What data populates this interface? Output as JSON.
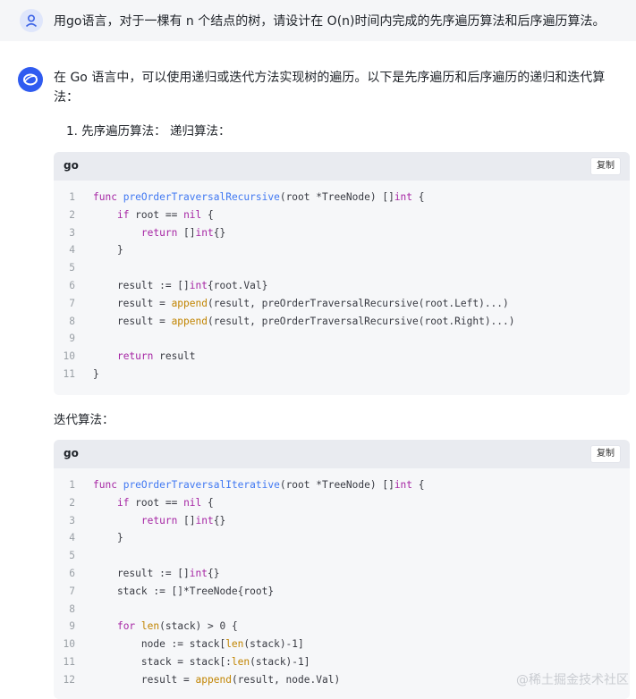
{
  "user": {
    "message": "用go语言，对于一棵有 n 个结点的树，请设计在 O(n)时间内完成的先序遍历算法和后序遍历算法。"
  },
  "assistant": {
    "intro": "在 Go 语言中，可以使用递归或迭代方法实现树的遍历。以下是先序遍历和后序遍历的递归和迭代算法：",
    "step1": "1. 先序遍历算法： 递归算法：",
    "iterative_label": "迭代算法："
  },
  "code_blocks": [
    {
      "lang": "go",
      "copy_label": "复制",
      "lines": [
        {
          "n": "1",
          "code": "func preOrderTraversalRecursive(root *TreeNode) []int {"
        },
        {
          "n": "2",
          "code": "    if root == nil {"
        },
        {
          "n": "3",
          "code": "        return []int{}"
        },
        {
          "n": "4",
          "code": "    }"
        },
        {
          "n": "5",
          "code": ""
        },
        {
          "n": "6",
          "code": "    result := []int{root.Val}"
        },
        {
          "n": "7",
          "code": "    result = append(result, preOrderTraversalRecursive(root.Left)...)"
        },
        {
          "n": "8",
          "code": "    result = append(result, preOrderTraversalRecursive(root.Right)...)"
        },
        {
          "n": "9",
          "code": ""
        },
        {
          "n": "10",
          "code": "    return result"
        },
        {
          "n": "11",
          "code": "}"
        }
      ]
    },
    {
      "lang": "go",
      "copy_label": "复制",
      "lines": [
        {
          "n": "1",
          "code": "func preOrderTraversalIterative(root *TreeNode) []int {"
        },
        {
          "n": "2",
          "code": "    if root == nil {"
        },
        {
          "n": "3",
          "code": "        return []int{}"
        },
        {
          "n": "4",
          "code": "    }"
        },
        {
          "n": "5",
          "code": ""
        },
        {
          "n": "6",
          "code": "    result := []int{}"
        },
        {
          "n": "7",
          "code": "    stack := []*TreeNode{root}"
        },
        {
          "n": "8",
          "code": ""
        },
        {
          "n": "9",
          "code": "    for len(stack) > 0 {"
        },
        {
          "n": "10",
          "code": "        node := stack[len(stack)-1]"
        },
        {
          "n": "11",
          "code": "        stack = stack[:len(stack)-1]"
        },
        {
          "n": "12",
          "code": "        result = append(result, node.Val)"
        }
      ]
    }
  ],
  "watermark": "@稀土掘金技术社区"
}
